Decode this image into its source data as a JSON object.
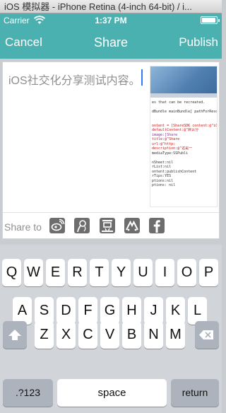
{
  "window": {
    "title": "iOS 模拟器 - iPhone Retina (4-inch 64-bit) / i..."
  },
  "status_bar": {
    "carrier": "Carrier",
    "time": "1:37 PM",
    "battery_level": 0.95
  },
  "nav": {
    "cancel": "Cancel",
    "title": "Share",
    "publish": "Publish"
  },
  "compose": {
    "text": "iOS社交化分享测试内容。",
    "thumbnail_code_lines": [
      "es that can be recreated.",
      "",
      "dBundle mainBundle] pathForResou",
      "",
      "",
      "ontent = [ShareSDK content:@\"iOS社",
      "          defaultContent:@\"默认分",
      "                   image:[Share",
      "                   title:@\"Share",
      "                     url:@\"http:",
      "             description:@\"这是一",
      "               mediaType:SSPubli",
      "",
      "nSheet:nil",
      "rList:nil",
      "ontent:publishContent",
      "rTips:YES",
      "ptions:nil",
      "ptions: nil",
      ""
    ],
    "share_to_label": "Share to",
    "platform_icons": [
      "sina-weibo-icon",
      "tencent-weibo-icon",
      "douban-icon",
      "renren-icon",
      "facebook-icon"
    ]
  },
  "keyboard": {
    "row1": [
      "Q",
      "W",
      "E",
      "R",
      "T",
      "Y",
      "U",
      "I",
      "O",
      "P"
    ],
    "row2": [
      "A",
      "S",
      "D",
      "F",
      "G",
      "H",
      "J",
      "K",
      "L"
    ],
    "row3": [
      "Z",
      "X",
      "C",
      "V",
      "B",
      "N",
      "M"
    ],
    "numbers_key": ".?123",
    "space_key": "space",
    "return_key": "return"
  },
  "colors": {
    "nav_teal": "#4ab0b0",
    "key_bg": "#ffffff",
    "keyboard_bg": "#d1d4d9",
    "cursor_blue": "#3478f6"
  }
}
